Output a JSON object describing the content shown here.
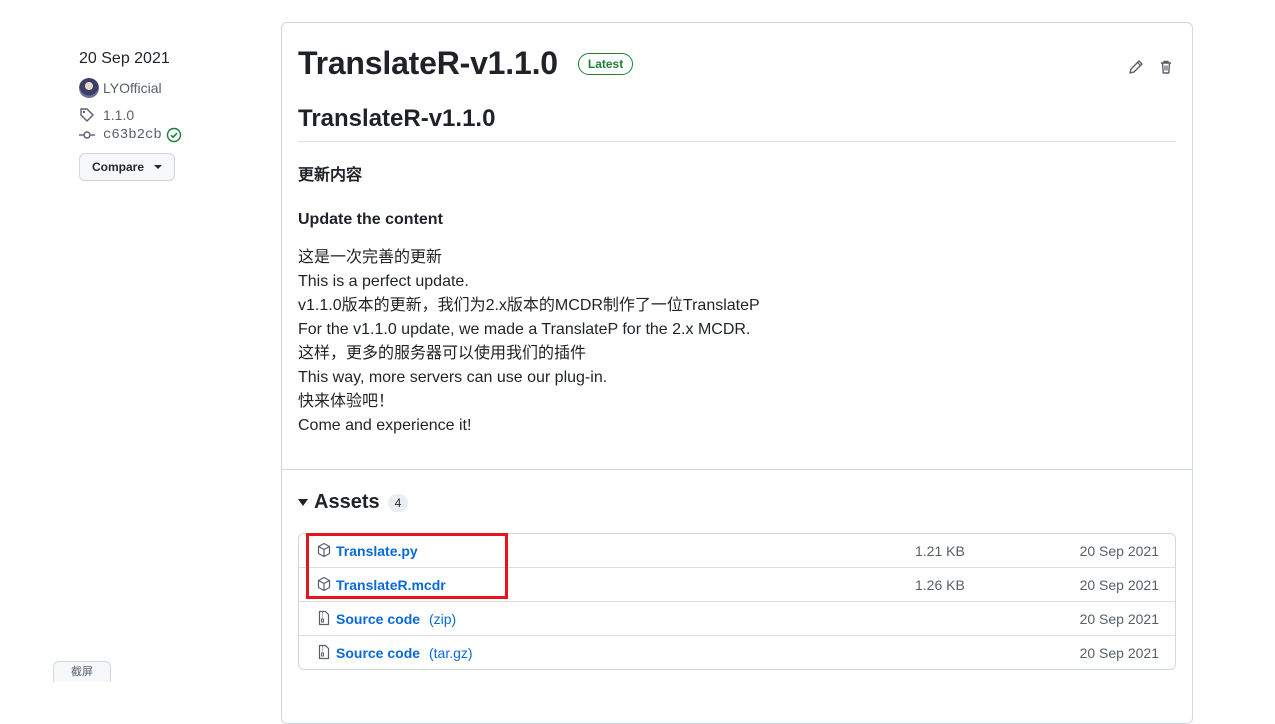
{
  "meta": {
    "date": "20 Sep 2021",
    "author": "LYOfficial",
    "tag": "1.1.0",
    "commit": "c63b2cb",
    "compare_label": "Compare"
  },
  "release": {
    "title": "TranslateR-v1.1.0",
    "badge": "Latest",
    "body": {
      "heading": "TranslateR-v1.1.0",
      "subheading_cn": "更新内容",
      "subheading_en": "Update the content",
      "lines": [
        "这是一次完善的更新",
        "This is a perfect update.",
        "v1.1.0版本的更新，我们为2.x版本的MCDR制作了一位TranslateP",
        "For the v1.1.0 update, we made a TranslateP for the 2.x MCDR.",
        "这样，更多的服务器可以使用我们的插件",
        "This way, more servers can use our plug-in.",
        "快来体验吧！",
        "Come and experience it!"
      ]
    }
  },
  "assets": {
    "title": "Assets",
    "count": "4",
    "items": [
      {
        "name": "Translate.py",
        "suffix": "",
        "size": "1.21 KB",
        "date": "20 Sep 2021",
        "icon": "package-icon"
      },
      {
        "name": "TranslateR.mcdr",
        "suffix": "",
        "size": "1.26 KB",
        "date": "20 Sep 2021",
        "icon": "package-icon"
      },
      {
        "name": "Source code",
        "suffix": "(zip)",
        "size": "",
        "date": "20 Sep 2021",
        "icon": "file-zip-icon"
      },
      {
        "name": "Source code",
        "suffix": "(tar.gz)",
        "size": "",
        "date": "20 Sep 2021",
        "icon": "file-zip-icon"
      }
    ]
  },
  "bottom_tab": "截屏",
  "colors": {
    "accent_link": "#0969da",
    "latest_green": "#1a7f37",
    "highlight_red": "#e3161b"
  }
}
